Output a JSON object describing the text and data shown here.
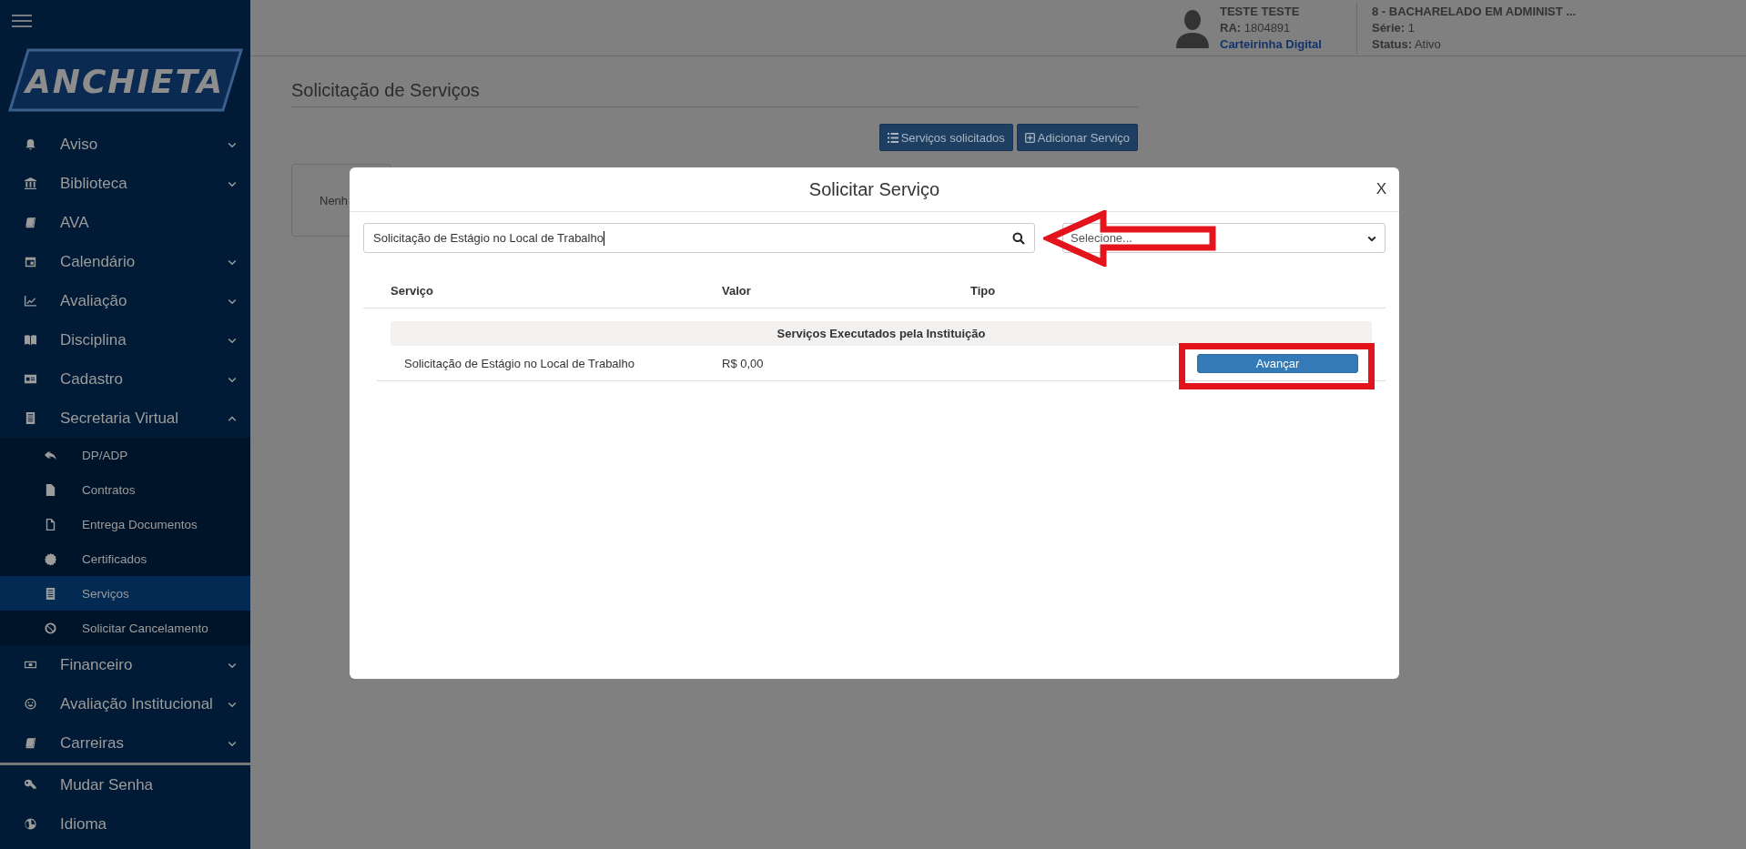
{
  "sidebar": {
    "logo": "ANCHIETA",
    "items": [
      {
        "label": "Aviso",
        "kind": "group",
        "expanded": false
      },
      {
        "label": "Biblioteca",
        "kind": "group",
        "expanded": false
      },
      {
        "label": "AVA",
        "kind": "link"
      },
      {
        "label": "Calendário",
        "kind": "group",
        "expanded": false
      },
      {
        "label": "Avaliação",
        "kind": "group",
        "expanded": false
      },
      {
        "label": "Disciplina",
        "kind": "group",
        "expanded": false
      },
      {
        "label": "Cadastro",
        "kind": "group",
        "expanded": false
      },
      {
        "label": "Secretaria Virtual",
        "kind": "group",
        "expanded": true,
        "children": [
          {
            "label": "DP/ADP",
            "selected": false
          },
          {
            "label": "Contratos",
            "selected": false
          },
          {
            "label": "Entrega Documentos",
            "selected": false
          },
          {
            "label": "Certificados",
            "selected": false
          },
          {
            "label": "Serviços",
            "selected": true
          },
          {
            "label": "Solicitar Cancelamento",
            "selected": false
          }
        ]
      },
      {
        "label": "Financeiro",
        "kind": "group",
        "expanded": false
      },
      {
        "label": "Avaliação Institucional",
        "kind": "group",
        "expanded": false
      },
      {
        "label": "Carreiras",
        "kind": "group",
        "expanded": false
      }
    ],
    "footer_items": [
      {
        "label": "Mudar Senha"
      },
      {
        "label": "Idioma"
      }
    ]
  },
  "header": {
    "user_name": "TESTE TESTE",
    "ra": "**RA:** 1804891",
    "card_link": "Carteirinha Digital",
    "course": "8 - BACHARELADO EM ADMINIST ...",
    "series": "**Série:** 1",
    "status": "**Status:** Ativo"
  },
  "page": {
    "title": "Solicitação de Serviços",
    "buttons": [
      {
        "label": "Serviços solicitados",
        "kind": "list"
      },
      {
        "label": "Adicionar Serviço",
        "kind": "add"
      }
    ],
    "card_text": "Nenh"
  },
  "modal": {
    "title": "Solicitar Serviço",
    "close": "X",
    "search": {
      "value": "Solicitação de Estágio no Local de Trabalho"
    },
    "filter": {
      "value": "Selecione..."
    },
    "table": {
      "columns": [
        "Serviço",
        "Valor",
        "Tipo"
      ],
      "groups": [
        {
          "title": "Serviços Executados pela Instituição",
          "rows": [
            {
              "service": "Solicitação de Estágio no Local de Trabalho",
              "value": "R$ 0,00",
              "action": "Avançar"
            }
          ]
        }
      ]
    }
  },
  "annotations": [
    {
      "kind": "arrow"
    },
    {
      "kind": "box"
    }
  ]
}
